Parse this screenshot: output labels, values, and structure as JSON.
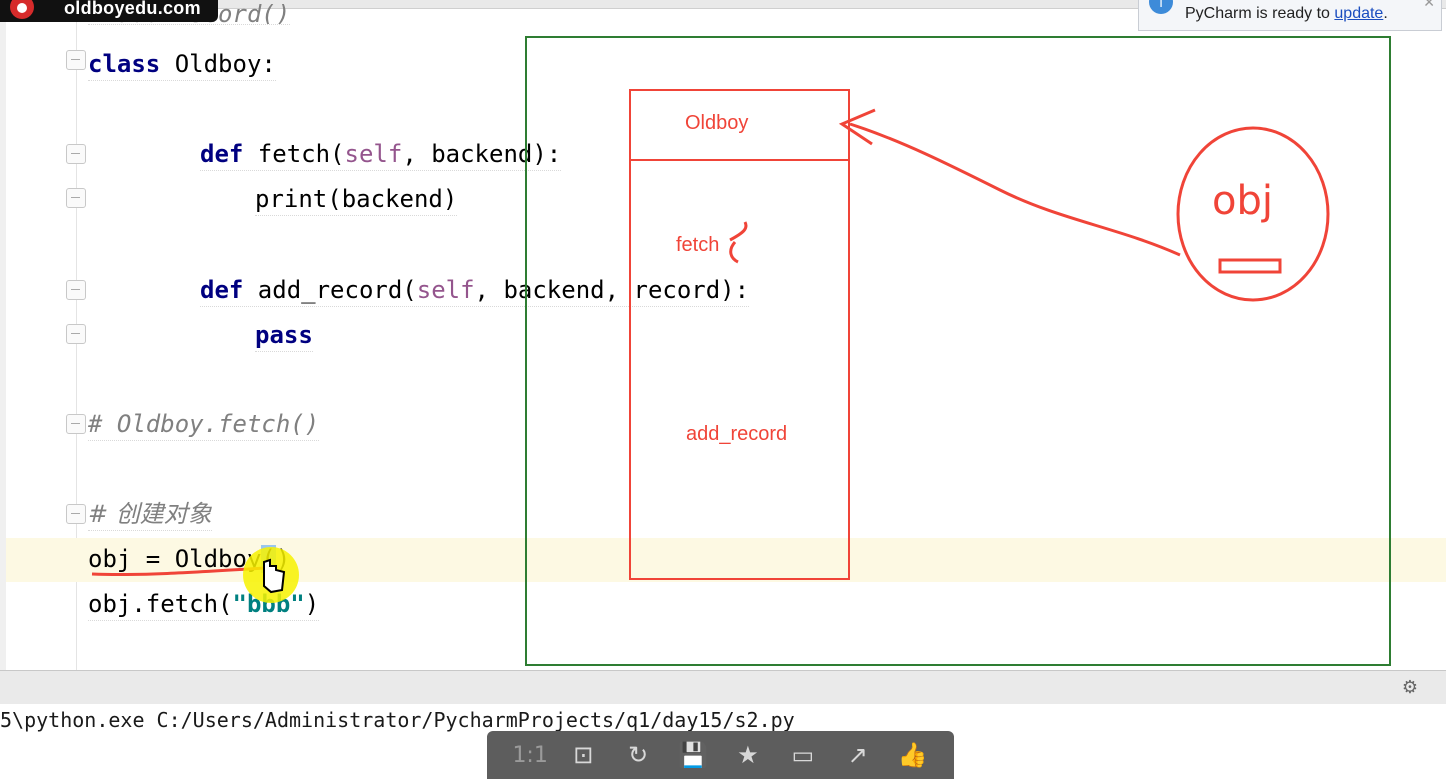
{
  "watermark": {
    "brand": "oldboyedu.com"
  },
  "notification": {
    "text": "PyCharm is ready to ",
    "link": "update",
    "suffix": "."
  },
  "code": {
    "comment_top": "# add_record()",
    "class_decl": {
      "kw": "class",
      "rest": " Oldboy:"
    },
    "fetch_def": {
      "kw": "def",
      "name": " fetch(",
      "self": "self",
      "rest": ", backend):"
    },
    "fetch_body": "print(backend)",
    "add_def": {
      "kw": "def",
      "name": " add_record(",
      "self": "self",
      "rest": ", backend, record):"
    },
    "add_body": "pass",
    "comment_fetch": "# Oldboy.fetch()",
    "comment_create": "# 创建对象",
    "obj_assign": {
      "pre": "obj = Oldboy",
      "open": "(",
      "close": ")"
    },
    "obj_call": {
      "pre": "obj.fetch(",
      "str": "\"bbb\"",
      "post": ")"
    }
  },
  "drawing": {
    "class_label": "Oldboy",
    "method_1": "fetch",
    "method_2": "add_record",
    "instance_label": "obj",
    "colors": {
      "ink": "#f04438",
      "frame": "#2e7d32"
    }
  },
  "run_output": "5\\python.exe C:/Users/Administrator/PycharmProjects/q1/day15/s2.py",
  "player_toolbar": [
    {
      "label": "1:1",
      "icon": "actual-size-icon"
    },
    {
      "label": "⊡",
      "icon": "fit-screen-icon"
    },
    {
      "label": "↻",
      "icon": "rotate-icon"
    },
    {
      "label": "💾",
      "icon": "save-icon"
    },
    {
      "label": "★",
      "icon": "bookmark-icon"
    },
    {
      "label": "▭",
      "icon": "tablet-icon"
    },
    {
      "label": "↗",
      "icon": "share-icon"
    },
    {
      "label": "👍",
      "icon": "thumbs-up-icon"
    }
  ]
}
